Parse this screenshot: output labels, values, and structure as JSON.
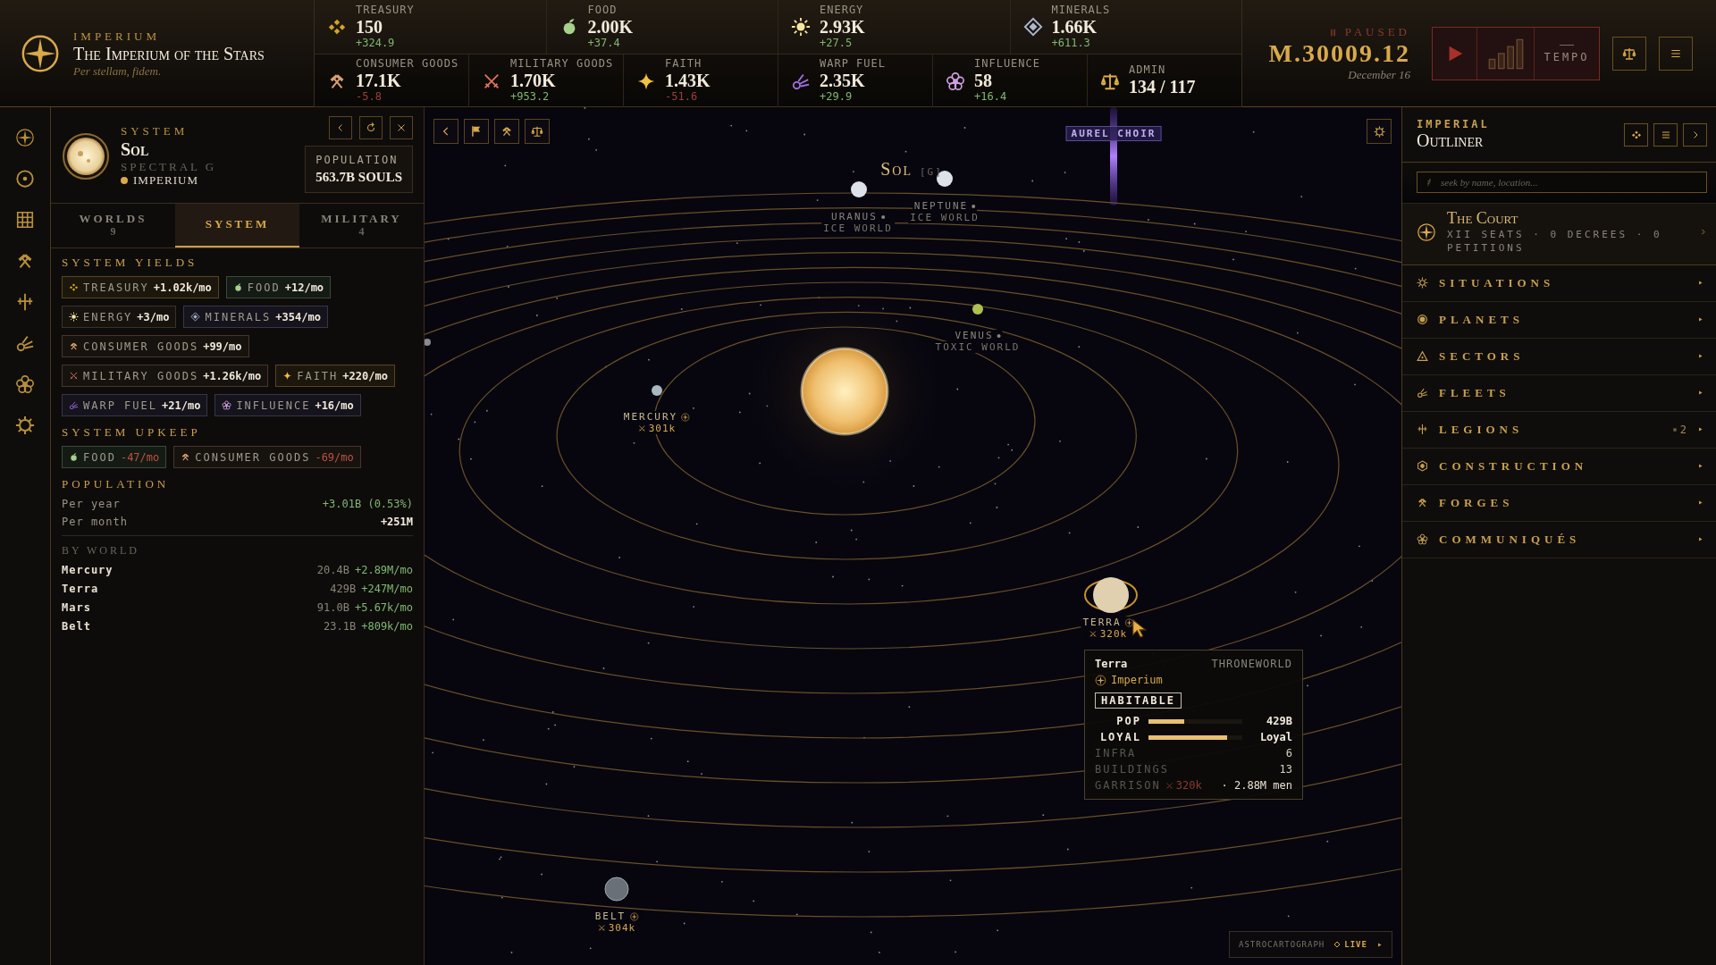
{
  "empire": {
    "kicker": "IMPERIUM",
    "name": "The Imperium of the Stars",
    "motto": "Per stellam, fidem."
  },
  "resources_top": [
    {
      "kind": "treasury",
      "label": "TREASURY",
      "value": "150",
      "delta": "+324.9",
      "negative": false
    },
    {
      "kind": "food",
      "label": "FOOD",
      "value": "2.00K",
      "delta": "+37.4",
      "negative": false
    },
    {
      "kind": "energy",
      "label": "ENERGY",
      "value": "2.93K",
      "delta": "+27.5",
      "negative": false
    },
    {
      "kind": "minerals",
      "label": "MINERALS",
      "value": "1.66K",
      "delta": "+611.3",
      "negative": false
    }
  ],
  "resources_bottom": [
    {
      "kind": "consumer_goods",
      "label": "CONSUMER GOODS",
      "value": "17.1K",
      "delta": "-5.8",
      "negative": true
    },
    {
      "kind": "military_goods",
      "label": "MILITARY GOODS",
      "value": "1.70K",
      "delta": "+953.2",
      "negative": false
    },
    {
      "kind": "faith",
      "label": "FAITH",
      "value": "1.43K",
      "delta": "-51.6",
      "negative": true
    },
    {
      "kind": "warp_fuel",
      "label": "WARP FUEL",
      "value": "2.35K",
      "delta": "+29.9",
      "negative": false
    },
    {
      "kind": "influence",
      "label": "INFLUENCE",
      "value": "58",
      "delta": "+16.4",
      "negative": false
    },
    {
      "kind": "admin",
      "label": "ADMIN",
      "value": "134 / 117"
    }
  ],
  "clock": {
    "paused": true,
    "status": "PAUSED",
    "date": "M.30009.12",
    "day": "December 16",
    "tempo": "TEMPO"
  },
  "system": {
    "kicker": "SYSTEM",
    "name": "Sol",
    "spectral": "SPECTRAL G",
    "owner": {
      "name": "IMPERIUM",
      "color": "#d9a94a"
    },
    "population_label": "POPULATION",
    "population": "563.7B SOULS"
  },
  "tabs": [
    {
      "label": "WORLDS",
      "count": "9",
      "selected": false
    },
    {
      "label": "SYSTEM",
      "selected": true
    },
    {
      "label": "MILITARY",
      "count": "4",
      "selected": false
    }
  ],
  "yields": {
    "title": "SYSTEM YIELDS",
    "chips": [
      {
        "kind": "treasury",
        "label": "TREASURY",
        "value": "+1.02k/mo",
        "negative": false
      },
      {
        "kind": "food",
        "label": "FOOD",
        "value": "+12/mo",
        "negative": false
      },
      {
        "kind": "energy",
        "label": "ENERGY",
        "value": "+3/mo",
        "negative": false
      },
      {
        "kind": "minerals",
        "label": "MINERALS",
        "value": "+354/mo",
        "negative": false
      },
      {
        "kind": "consumer_goods",
        "label": "CONSUMER GOODS",
        "value": "+99/mo",
        "negative": false
      },
      {
        "kind": "military_goods",
        "label": "MILITARY GOODS",
        "value": "+1.26k/mo",
        "negative": false
      },
      {
        "kind": "faith",
        "label": "FAITH",
        "value": "+220/mo",
        "negative": false
      },
      {
        "kind": "warp_fuel",
        "label": "WARP FUEL",
        "value": "+21/mo",
        "negative": false
      },
      {
        "kind": "influence",
        "label": "INFLUENCE",
        "value": "+16/mo",
        "negative": false
      }
    ]
  },
  "upkeep": {
    "title": "SYSTEM UPKEEP",
    "chips": [
      {
        "kind": "food",
        "label": "FOOD",
        "value": "-47/mo",
        "negative": true
      },
      {
        "kind": "consumer_goods",
        "label": "CONSUMER GOODS",
        "value": "-69/mo",
        "negative": true
      }
    ]
  },
  "population": {
    "title": "POPULATION",
    "rows": [
      {
        "label": "Per year",
        "value": "+3.01B (0.53%)",
        "highlight": false
      },
      {
        "label": "Per month",
        "value": "+251M",
        "highlight": true
      }
    ],
    "by_world_title": "BY WORLD",
    "worlds": [
      {
        "name": "Mercury",
        "pop": "20.4B",
        "growth": "+2.89M/mo"
      },
      {
        "name": "Terra",
        "pop": "429B",
        "growth": "+247M/mo"
      },
      {
        "name": "Mars",
        "pop": "91.0B",
        "growth": "+5.67k/mo"
      },
      {
        "name": "Belt",
        "pop": "23.1B",
        "growth": "+809k/mo"
      }
    ]
  },
  "map": {
    "title": "Sol",
    "title_tag": "[G]",
    "beacon": "AUREL CHOIR",
    "planets": [
      {
        "name": "URANUS",
        "class": "ICE WORLD",
        "owned": false
      },
      {
        "name": "NEPTUNE",
        "class": "ICE WORLD",
        "owned": false
      },
      {
        "name": "VENUS",
        "class": "TOXIC WORLD",
        "owned": false
      },
      {
        "name": "MERCURY",
        "garrison": "301k",
        "owned": true
      },
      {
        "name": "TERRA",
        "garrison": "320k",
        "owned": true
      },
      {
        "name": "BELT",
        "garrison": "304k",
        "owned": true
      }
    ],
    "tooltip": {
      "name": "Terra",
      "class": "THRONEWORLD",
      "owner": "Imperium",
      "tag": "HABITABLE",
      "bars": [
        {
          "label": "POP",
          "level": 0.38,
          "value": "429B"
        },
        {
          "label": "LOYAL",
          "level": 0.84,
          "value": "Loyal"
        }
      ],
      "stats": [
        {
          "label": "INFRA",
          "value": "6"
        },
        {
          "label": "BUILDINGS",
          "value": "13"
        }
      ],
      "garrison": {
        "label": "GARRISON",
        "troops": "320k",
        "men": "· 2.88M men"
      }
    },
    "footer": {
      "label": "ASTROCARTOGRAPH",
      "status": "LIVE"
    }
  },
  "outliner": {
    "kicker": "IMPERIAL",
    "title": "Outliner",
    "search": {
      "placeholder": "seek by name, location..."
    },
    "court": {
      "title": "The Court",
      "subtitle": "XII SEATS · 0 DECREES · 0 PETITIONS"
    },
    "items": [
      {
        "kind": "situations",
        "label": "SITUATIONS"
      },
      {
        "kind": "planets",
        "label": "PLANETS"
      },
      {
        "kind": "sectors",
        "label": "SECTORS"
      },
      {
        "kind": "fleets",
        "label": "FLEETS"
      },
      {
        "kind": "legions",
        "label": "LEGIONS",
        "count": "2"
      },
      {
        "kind": "construction",
        "label": "CONSTRUCTION"
      },
      {
        "kind": "forges",
        "label": "FORGES"
      },
      {
        "kind": "communiques",
        "label": "COMMUNIQUÉS"
      }
    ]
  }
}
